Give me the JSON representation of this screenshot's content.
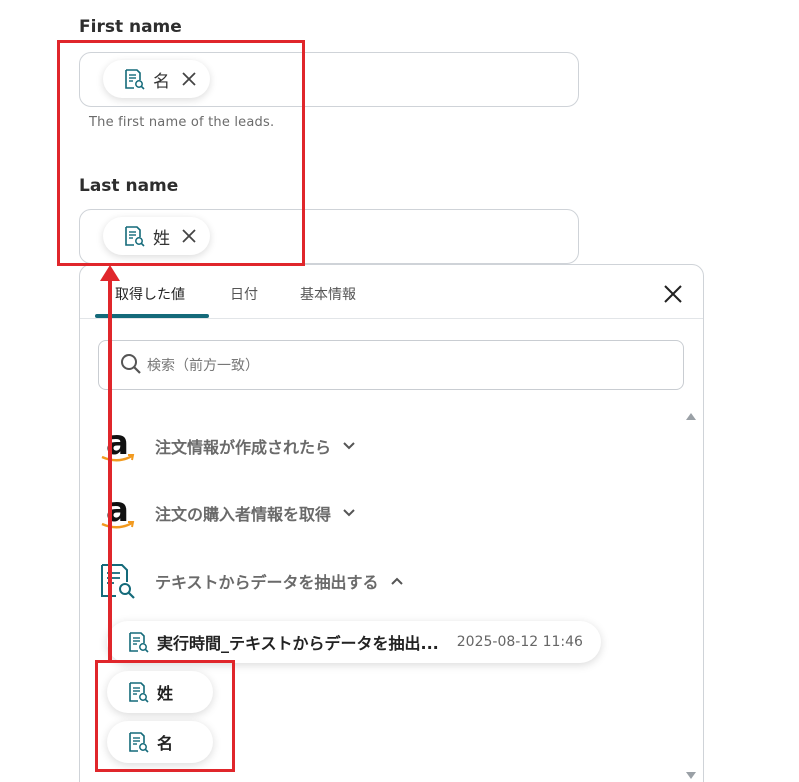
{
  "fields": {
    "first_name": {
      "label": "First name",
      "chip_text": "名",
      "help": "The first name of the leads."
    },
    "last_name": {
      "label": "Last name",
      "chip_text": "姓"
    }
  },
  "panel": {
    "tabs": [
      {
        "label": "取得した値",
        "active": true
      },
      {
        "label": "日付",
        "active": false
      },
      {
        "label": "基本情報",
        "active": false
      }
    ],
    "search_placeholder": "検索（前方一致）",
    "groups": [
      {
        "label": "注文情報が作成されたら",
        "icon": "amazon-logo",
        "expanded": false
      },
      {
        "label": "注文の購入者情報を取得",
        "icon": "amazon-logo",
        "expanded": false
      },
      {
        "label": "テキストからデータを抽出する",
        "icon": "doc-search-icon",
        "expanded": true
      }
    ],
    "values": [
      {
        "name": "実行時間_テキストからデータを抽出...",
        "time": "2025-08-12 11:46"
      },
      {
        "name": "姓"
      },
      {
        "name": "名"
      }
    ]
  },
  "colors": {
    "accent": "#146a7a",
    "highlight": "#e0262b",
    "amazon_orange": "#f29a1f"
  }
}
